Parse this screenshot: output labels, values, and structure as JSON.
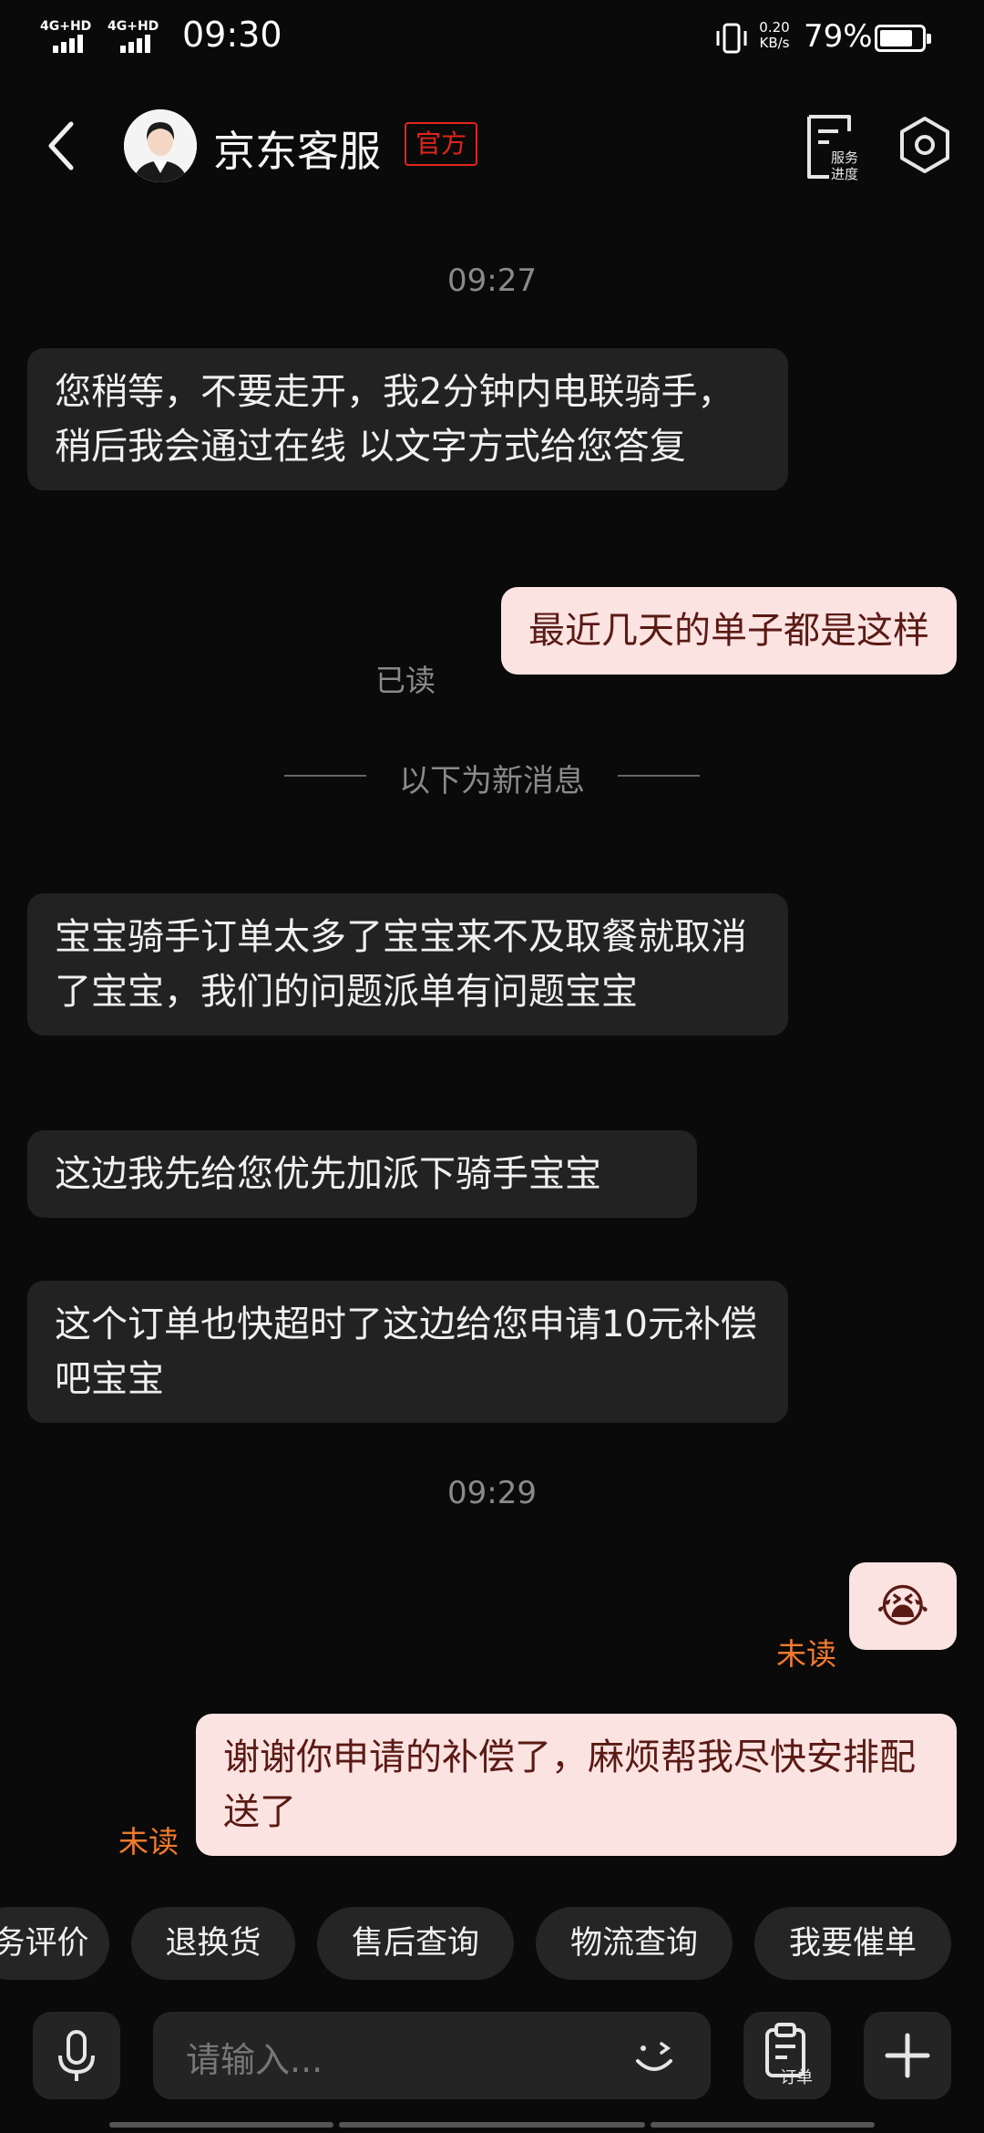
{
  "status_bar": {
    "network1": "4G+HD",
    "network2": "4G+HD",
    "time": "09:30",
    "net_speed_value": "0.20",
    "net_speed_unit": "KB/s",
    "battery_percent": "79%",
    "battery_level": 0.79
  },
  "header": {
    "agent_name": "京东客服",
    "official_badge": "官方",
    "service_progress_label": "服务进度"
  },
  "chat": {
    "time1": "09:27",
    "msg1": "您稍等，不要走开，我2分钟内电联骑手，稍后我会通过在线  以文字方式给您答复",
    "msg2": "最近几天的单子都是这样",
    "msg2_status": "已读",
    "new_divider": "以下为新消息",
    "msg3": "宝宝骑手订单太多了宝宝来不及取餐就取消了宝宝，我们的问题派单有问题宝宝",
    "msg4": "这边我先给您优先加派下骑手宝宝",
    "msg5": "这个订单也快超时了这边给您申请10元补偿吧宝宝",
    "time2": "09:29",
    "msg6": "😭",
    "msg6_status": "未读",
    "msg7": "谢谢你申请的补偿了，麻烦帮我尽快安排配送了",
    "msg7_status": "未读"
  },
  "quick_actions": [
    "务评价",
    "退换货",
    "售后查询",
    "物流查询",
    "我要催单"
  ],
  "input": {
    "placeholder": "请输入...",
    "order_label": "订单"
  },
  "colors": {
    "background": "#0a0a0a",
    "incoming_bubble": "#222222",
    "outgoing_bubble": "#fbe3e2",
    "brand_red": "#e1251b",
    "unread_orange": "#f27b2c"
  }
}
